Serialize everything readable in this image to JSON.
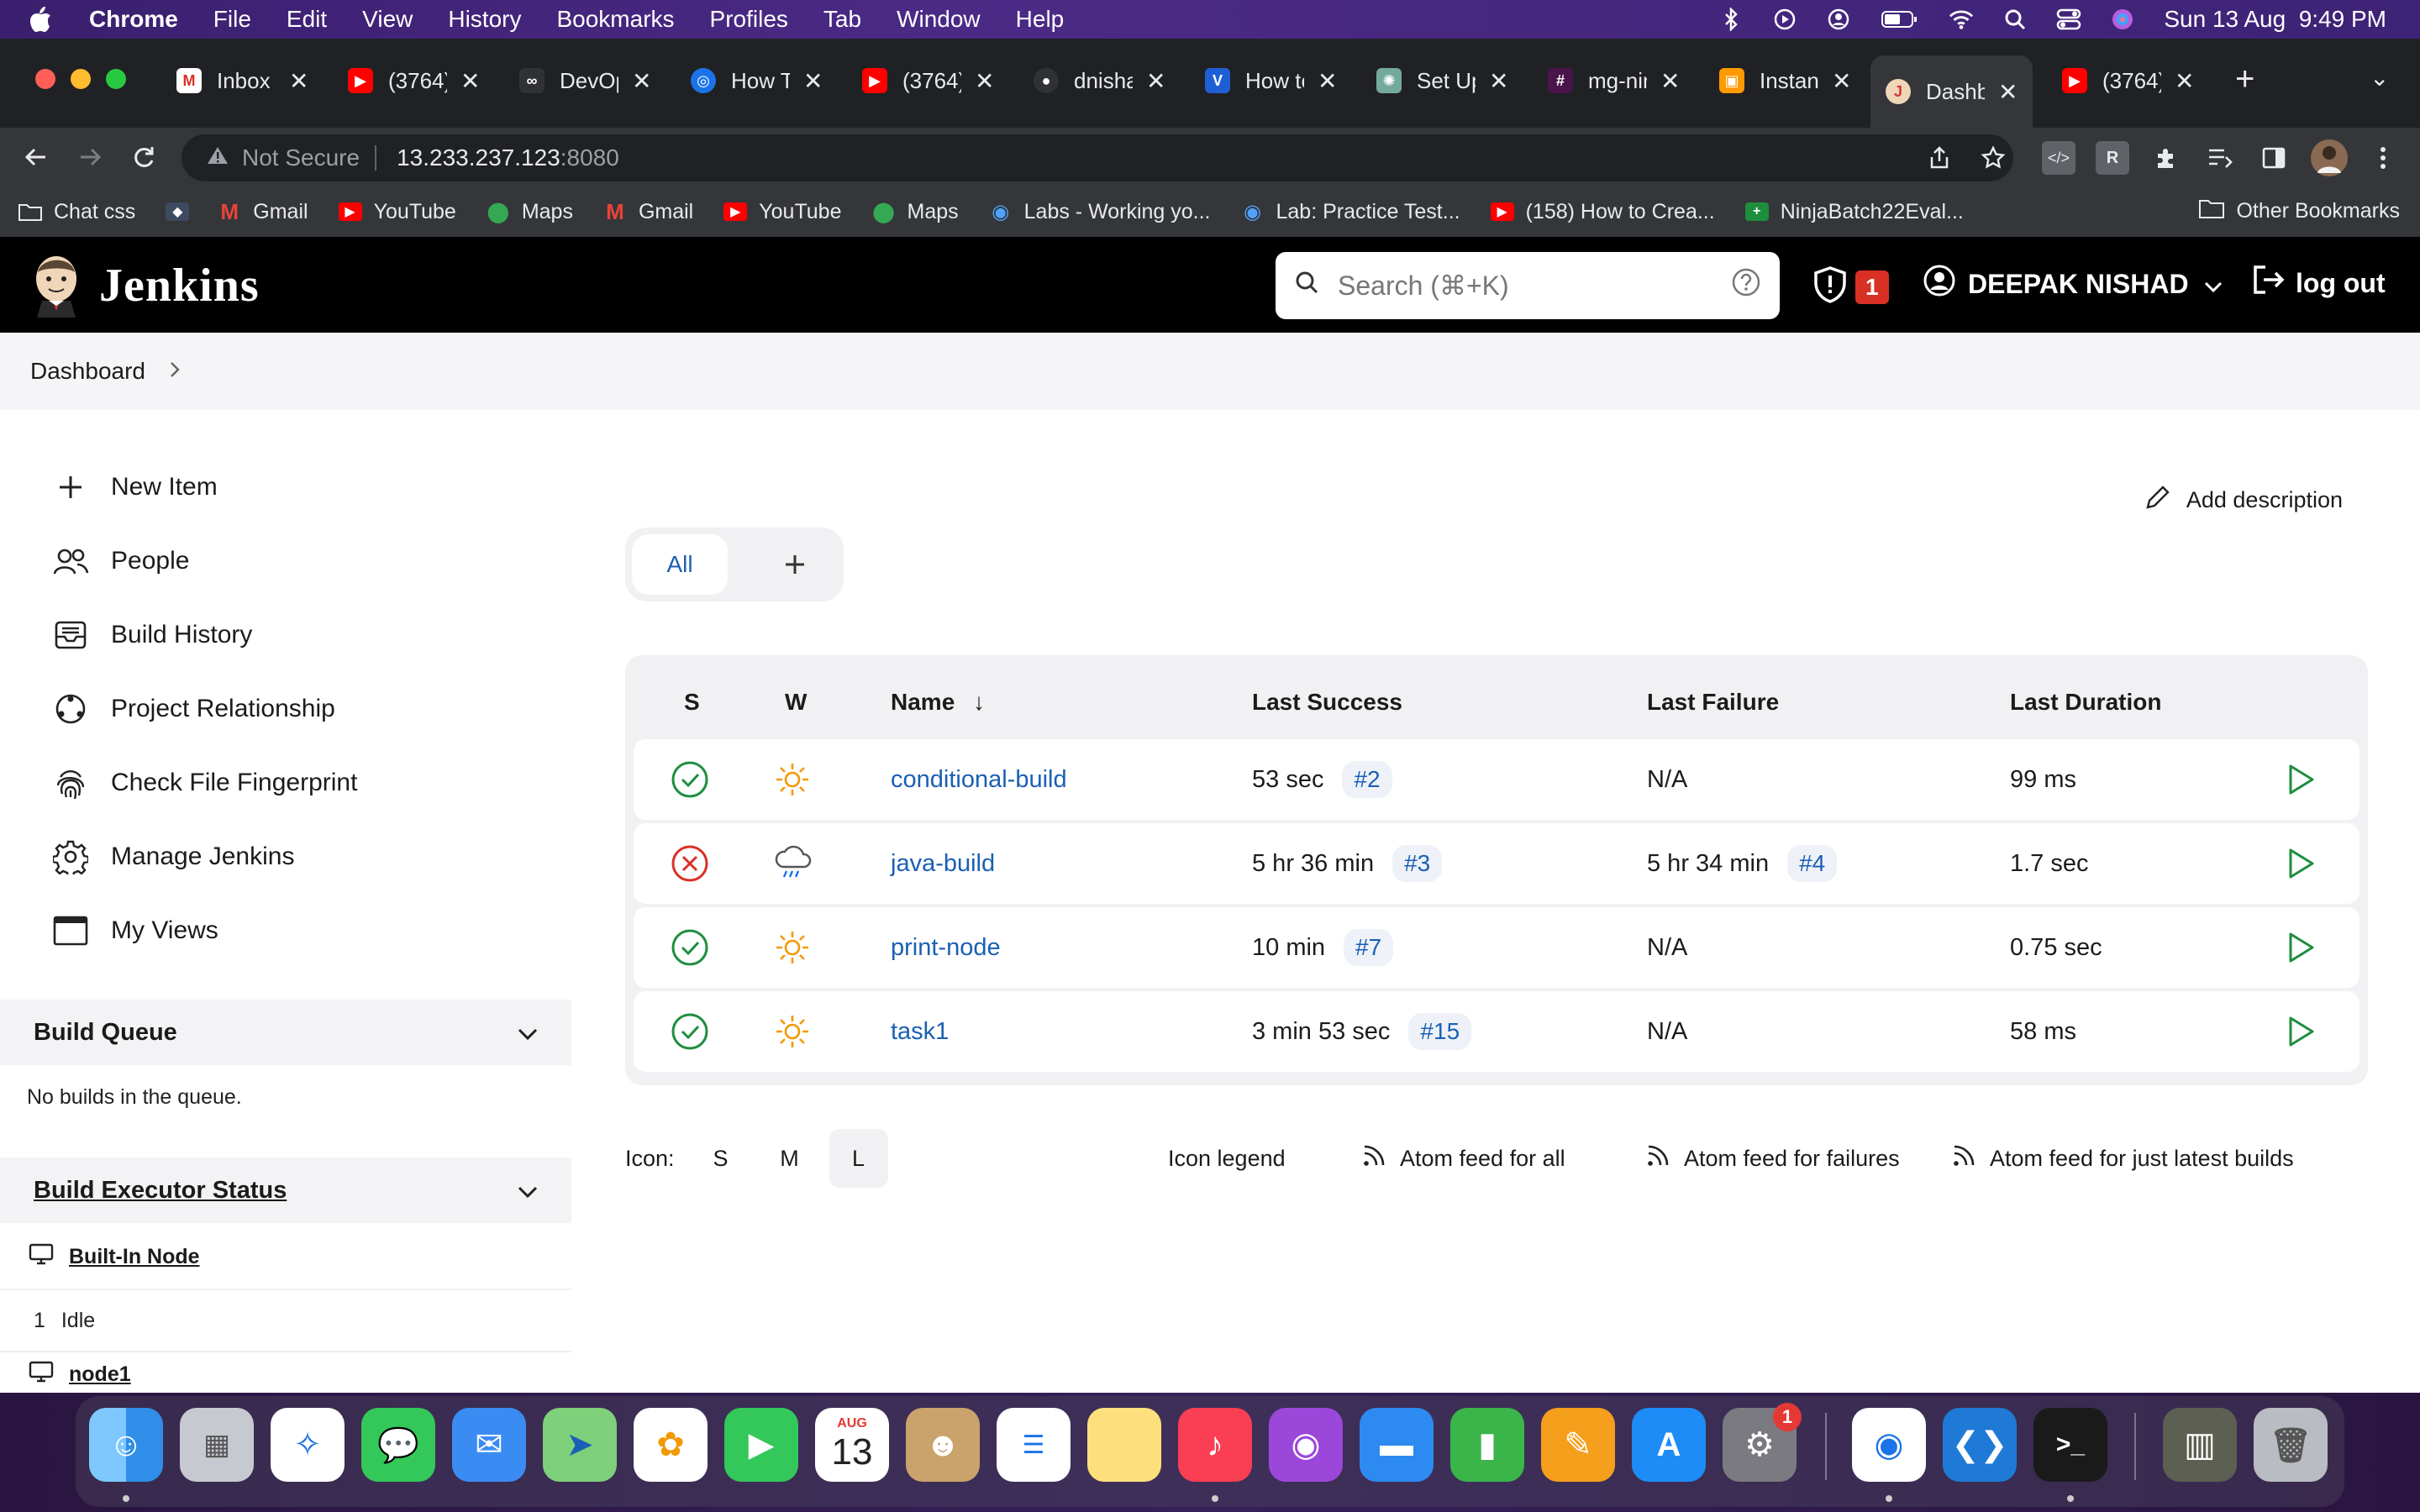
{
  "menubar": {
    "app": "Chrome",
    "items": [
      "File",
      "Edit",
      "View",
      "History",
      "Bookmarks",
      "Profiles",
      "Tab",
      "Window",
      "Help"
    ],
    "clock": "Sun 13 Aug  9:49 PM"
  },
  "tabs": [
    {
      "title": "Inbox (",
      "icon": "gmail-icon",
      "color": "#ffffff"
    },
    {
      "title": "(3764)",
      "icon": "youtube-icon",
      "color": "#ff0000"
    },
    {
      "title": "DevOp",
      "icon": "devops-icon",
      "color": "#303134"
    },
    {
      "title": "How To",
      "icon": "blue-loop-icon",
      "color": "#1a73e8"
    },
    {
      "title": "(3764)",
      "icon": "youtube-icon",
      "color": "#ff0000"
    },
    {
      "title": "dnisha",
      "icon": "github-icon",
      "color": "#303134"
    },
    {
      "title": "How to",
      "icon": "v-logo-icon",
      "color": "#1f5fd6"
    },
    {
      "title": "Set Up",
      "icon": "chatgpt-icon",
      "color": "#74aa9c"
    },
    {
      "title": "mg-nir",
      "icon": "slack-icon",
      "color": "#4a154b"
    },
    {
      "title": "Instanc",
      "icon": "aws-icon",
      "color": "#ff9900"
    },
    {
      "title": "Dashbo",
      "icon": "jenkins-icon",
      "color": "#d33833",
      "active": true
    },
    {
      "title": "(3764)",
      "icon": "youtube-icon",
      "color": "#ff0000"
    }
  ],
  "address": {
    "security": "Not Secure",
    "host": "13.233.237.123",
    "port": ":8080"
  },
  "bookmarks": [
    {
      "label": "Chat css",
      "icon": "folder-icon"
    },
    {
      "label": "",
      "icon": "bat-icon"
    },
    {
      "label": "Gmail",
      "icon": "gmail-icon"
    },
    {
      "label": "YouTube",
      "icon": "youtube-icon"
    },
    {
      "label": "Maps",
      "icon": "maps-icon"
    },
    {
      "label": "Gmail",
      "icon": "gmail-icon"
    },
    {
      "label": "YouTube",
      "icon": "youtube-icon"
    },
    {
      "label": "Maps",
      "icon": "maps-icon"
    },
    {
      "label": "Labs - Working yo...",
      "icon": "eye-icon"
    },
    {
      "label": "Lab: Practice Test...",
      "icon": "eye-icon"
    },
    {
      "label": "(158) How to Crea...",
      "icon": "youtube-icon"
    },
    {
      "label": "NinjaBatch22Eval...",
      "icon": "sheets-icon"
    }
  ],
  "other_bookmarks": "Other Bookmarks",
  "jenkins": {
    "title": "Jenkins",
    "search_placeholder": "Search (⌘+K)",
    "alert_count": "1",
    "user": "DEEPAK NISHAD",
    "logout": "log out",
    "breadcrumb": "Dashboard",
    "tasks": [
      {
        "label": "New Item",
        "icon": "plus-icon"
      },
      {
        "label": "People",
        "icon": "people-icon"
      },
      {
        "label": "Build History",
        "icon": "inbox-icon"
      },
      {
        "label": "Project Relationship",
        "icon": "relationship-icon"
      },
      {
        "label": "Check File Fingerprint",
        "icon": "fingerprint-icon"
      },
      {
        "label": "Manage Jenkins",
        "icon": "gear-icon"
      },
      {
        "label": "My Views",
        "icon": "window-icon"
      }
    ],
    "build_queue": {
      "title": "Build Queue",
      "empty": "No builds in the queue."
    },
    "executors": {
      "title": "Build Executor Status",
      "nodes": [
        {
          "name": "Built-In Node",
          "executors": [
            {
              "num": "1",
              "state": "Idle"
            }
          ]
        },
        {
          "name": "node1"
        }
      ]
    },
    "add_description": "Add description",
    "view_tabs": [
      "All"
    ],
    "columns": {
      "s": "S",
      "w": "W",
      "name": "Name",
      "name_sort": "↓",
      "last_success": "Last Success",
      "last_failure": "Last Failure",
      "last_duration": "Last Duration"
    },
    "jobs": [
      {
        "status": "success",
        "weather": "sunny",
        "name": "conditional-build",
        "last_success": "53 sec",
        "success_build": "#2",
        "last_failure": "N/A",
        "failure_build": "",
        "duration": "99 ms"
      },
      {
        "status": "failed",
        "weather": "rain",
        "name": "java-build",
        "last_success": "5 hr 36 min",
        "success_build": "#3",
        "last_failure": "5 hr 34 min",
        "failure_build": "#4",
        "duration": "1.7 sec"
      },
      {
        "status": "success",
        "weather": "sunny",
        "name": "print-node",
        "last_success": "10 min",
        "success_build": "#7",
        "last_failure": "N/A",
        "failure_build": "",
        "duration": "0.75 sec"
      },
      {
        "status": "success",
        "weather": "sunny",
        "name": "task1",
        "last_success": "3 min 53 sec",
        "success_build": "#15",
        "last_failure": "N/A",
        "failure_build": "",
        "duration": "58 ms"
      }
    ],
    "icon_size": {
      "label": "Icon:",
      "options": [
        "S",
        "M",
        "L"
      ],
      "selected": "L"
    },
    "icon_legend": "Icon legend",
    "feeds": [
      "Atom feed for all",
      "Atom feed for failures",
      "Atom feed for just latest builds"
    ]
  },
  "dock": {
    "apps": [
      "finder",
      "launchpad",
      "safari",
      "messages",
      "mail",
      "maps",
      "photos",
      "facetime",
      "calendar",
      "contacts",
      "reminders",
      "notes",
      "music",
      "podcasts",
      "keynote",
      "numbers",
      "pages",
      "app-store",
      "system-settings",
      "chrome",
      "vscode",
      "terminal",
      "preview",
      "trash"
    ],
    "calendar_month": "AUG",
    "calendar_day": "13",
    "settings_badge": "1"
  }
}
